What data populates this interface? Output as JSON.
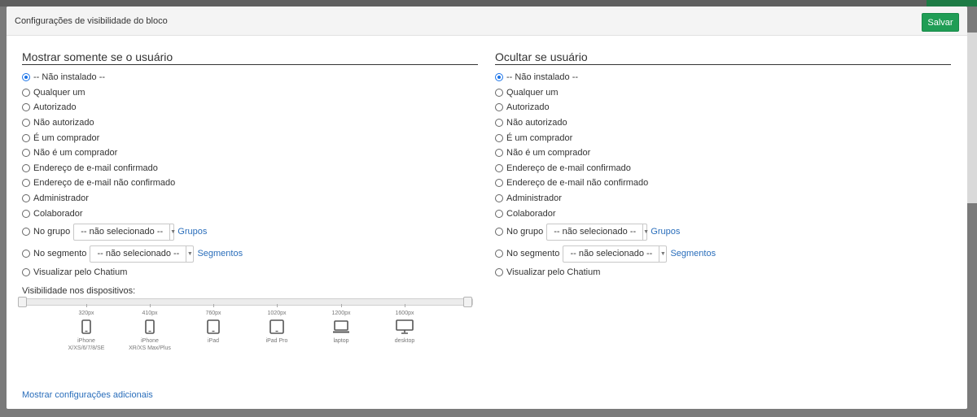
{
  "modal": {
    "title": "Configurações de visibilidade do bloco",
    "save_label": "Salvar",
    "more_settings_link": "Mostrar configurações adicionais"
  },
  "left": {
    "title": "Mostrar somente se o usuário",
    "options": [
      "-- Não instalado --",
      "Qualquer um",
      "Autorizado",
      "Não autorizado",
      "É um comprador",
      "Não é um comprador",
      "Endereço de e-mail confirmado",
      "Endereço de e-mail não confirmado",
      "Administrador",
      "Colaborador",
      "No grupo",
      "No segmento",
      "Visualizar pelo Chatium"
    ],
    "group_select": "-- não selecionado --",
    "group_link": "Grupos",
    "segment_select": "-- não selecionado --",
    "segment_link": "Segmentos"
  },
  "right": {
    "title": "Ocultar se usuário",
    "options": [
      "-- Não instalado --",
      "Qualquer um",
      "Autorizado",
      "Não autorizado",
      "É um comprador",
      "Não é um comprador",
      "Endereço de e-mail confirmado",
      "Endereço de e-mail não confirmado",
      "Administrador",
      "Colaborador",
      "No grupo",
      "No segmento",
      "Visualizar pelo Chatium"
    ],
    "group_select": "-- não selecionado --",
    "group_link": "Grupos",
    "segment_select": "-- não selecionado --",
    "segment_link": "Segmentos"
  },
  "devices": {
    "label": "Visibilidade nos dispositivos:",
    "items": [
      {
        "px": "320px",
        "name1": "iPhone",
        "name2": "X/XS/6/7/8/SE",
        "icon": "phone-icon"
      },
      {
        "px": "410px",
        "name1": "iPhone",
        "name2": "XR/XS Max/Plus",
        "icon": "phone-icon"
      },
      {
        "px": "760px",
        "name1": "iPad",
        "name2": "",
        "icon": "tablet-icon"
      },
      {
        "px": "1020px",
        "name1": "iPad Pro",
        "name2": "",
        "icon": "tablet-icon"
      },
      {
        "px": "1200px",
        "name1": "laptop",
        "name2": "",
        "icon": "laptop-icon"
      },
      {
        "px": "1600px",
        "name1": "desktop",
        "name2": "",
        "icon": "desktop-icon"
      }
    ]
  },
  "colors": {
    "accent": "#1f9d55",
    "link": "#2a6ebb",
    "radio_checked": "#1a73e8"
  }
}
